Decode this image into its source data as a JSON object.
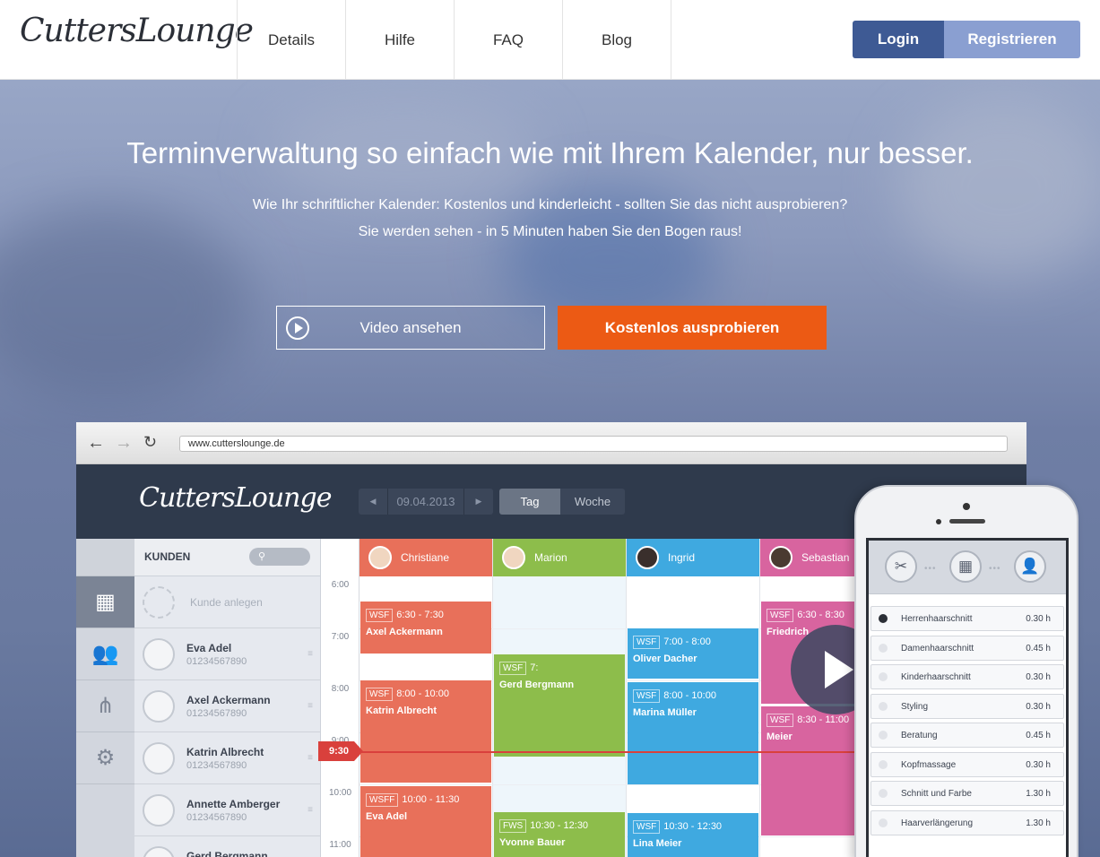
{
  "nav": {
    "logo": "CuttersLounge",
    "links": [
      "Details",
      "Hilfe",
      "FAQ",
      "Blog"
    ],
    "login": "Login",
    "register": "Registrieren"
  },
  "hero": {
    "title": "Terminverwaltung so einfach wie mit Ihrem Kalender, nur besser.",
    "subtitle_1": "Wie Ihr schriftlicher Kalender: Kostenlos und kinderleicht - sollten Sie das nicht ausprobieren?",
    "subtitle_2": "Sie werden sehen - in 5 Minuten haben Sie den Bogen raus!",
    "video_button": "Video ansehen",
    "try_button": "Kostenlos ausprobieren"
  },
  "browser": {
    "url": "www.cutterslounge.de",
    "app_logo": "CuttersLounge",
    "date": "09.04.2013",
    "view_day": "Tag",
    "view_week": "Woche",
    "customers_title": "KUNDEN",
    "create_customer": "Kunde anlegen",
    "customers": [
      {
        "name": "Eva Adel",
        "phone": "01234567890"
      },
      {
        "name": "Axel Ackermann",
        "phone": "01234567890"
      },
      {
        "name": "Katrin Albrecht",
        "phone": "01234567890"
      },
      {
        "name": "Annette Amberger",
        "phone": "01234567890"
      },
      {
        "name": "Gerd Bergmann",
        "phone": ""
      }
    ],
    "times": [
      "6:00",
      "7:00",
      "8:00",
      "9:00",
      "10:00",
      "11:00"
    ],
    "now": "9:30",
    "staff": [
      {
        "name": "Christiane",
        "color": "#e8705a"
      },
      {
        "name": "Marion",
        "color": "#8dbd4b"
      },
      {
        "name": "Ingrid",
        "color": "#3fa9e0"
      },
      {
        "name": "Sebastian",
        "color": "#d8649f"
      }
    ],
    "events": [
      {
        "tag": "WSF",
        "time": "6:30 - 7:30",
        "name": "Axel Ackermann"
      },
      {
        "tag": "WSF",
        "time": "8:00 - 10:00",
        "name": "Katrin Albrecht"
      },
      {
        "tag": "WSFF",
        "time": "10:00 - 11:30",
        "name": "Eva Adel"
      },
      {
        "tag": "WSF",
        "time": "7:",
        "name": "Gerd Bergmann"
      },
      {
        "tag": "FWS",
        "time": "10:30 - 12:30",
        "name": "Yvonne Bauer"
      },
      {
        "tag": "WSF",
        "time": "7:00 - 8:00",
        "name": "Oliver Dacher"
      },
      {
        "tag": "WSF",
        "time": "8:00 - 10:00",
        "name": "Marina Müller"
      },
      {
        "tag": "WSF",
        "time": "10:30 - 12:30",
        "name": "Lina Meier"
      },
      {
        "tag": "WSF",
        "time": "6:30 - 8:30",
        "name": "Friedrich"
      },
      {
        "tag": "WSF",
        "time": "8:30 - 11:00",
        "name": "Meier"
      }
    ]
  },
  "phone": {
    "services": [
      {
        "name": "Herrenhaarschnitt",
        "duration": "0.30 h",
        "selected": true
      },
      {
        "name": "Damenhaarschnitt",
        "duration": "0.45 h",
        "selected": false
      },
      {
        "name": "Kinderhaarschnitt",
        "duration": "0.30 h",
        "selected": false
      },
      {
        "name": "Styling",
        "duration": "0.30 h",
        "selected": false
      },
      {
        "name": "Beratung",
        "duration": "0.45 h",
        "selected": false
      },
      {
        "name": "Kopfmassage",
        "duration": "0.30 h",
        "selected": false
      },
      {
        "name": "Schnitt und Farbe",
        "duration": "1.30 h",
        "selected": false
      },
      {
        "name": "Haarverlängerung",
        "duration": "1.30 h",
        "selected": false
      }
    ]
  }
}
